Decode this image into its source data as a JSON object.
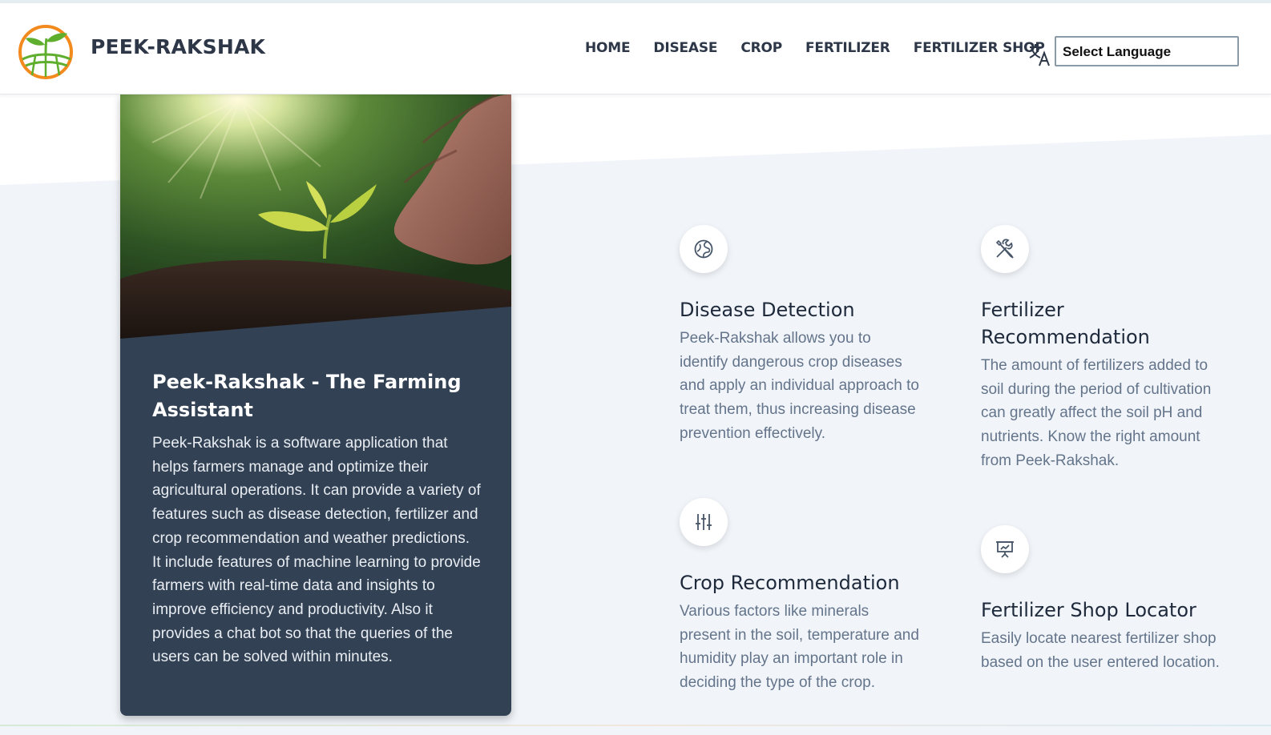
{
  "brand": {
    "name": "PEEK-RAKSHAK"
  },
  "nav": {
    "items": [
      "HOME",
      "DISEASE",
      "CROP",
      "FERTILIZER",
      "FERTILIZER SHOP"
    ],
    "language_select": "Select Language"
  },
  "hero_card": {
    "title": "Peek-Rakshak - The Farming Assistant",
    "text": "Peek-Rakshak is a software application that helps farmers manage and optimize their agricultural operations. It can provide a variety of features such as disease detection, fertilizer and crop recommendation and weather predictions. It include features of machine learning to provide farmers with real-time data and insights to improve efficiency and productivity. Also it provides a chat bot so that the queries of the users can be solved within minutes."
  },
  "features": [
    {
      "icon": "globe-icon",
      "title": "Disease Detection",
      "text": "Peek-Rakshak allows you to identify dangerous crop diseases and apply an individual approach to treat them, thus increasing disease prevention effectively."
    },
    {
      "icon": "tools-icon",
      "title": "Fertilizer Recommendation",
      "text": "The amount of fertilizers added to soil during the period of cultivation can greatly affect the soil pH and nutrients. Know the right amount from Peek-Rakshak."
    },
    {
      "icon": "sliders-icon",
      "title": "Crop Recommendation",
      "text": "Various factors like minerals present in the soil, temperature and humidity play an important role in deciding the type of the crop."
    },
    {
      "icon": "presentation-chart-icon",
      "title": "Fertilizer Shop Locator",
      "text": "Easily locate nearest fertilizer shop based on the user entered location."
    }
  ],
  "colors": {
    "card_bg": "#334155",
    "section_bg": "#f1f5f9",
    "logo_orange": "#f28a1e",
    "logo_green": "#5fae2e"
  }
}
